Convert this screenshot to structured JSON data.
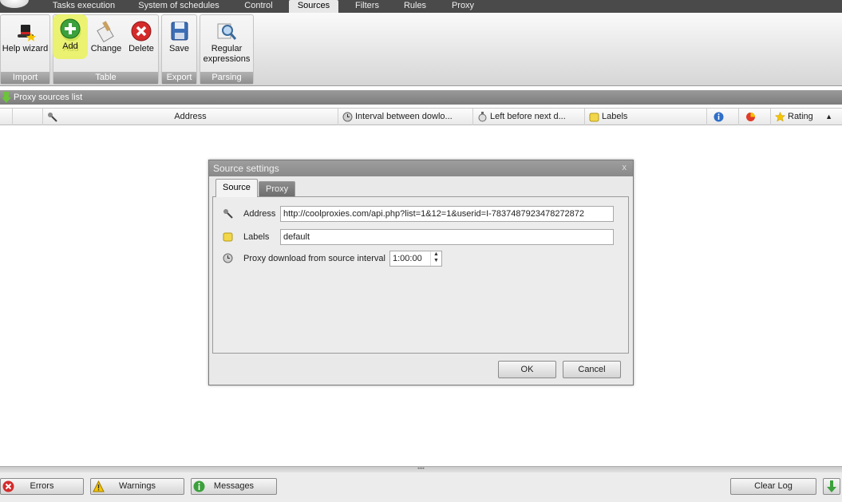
{
  "tabs": [
    "Tasks execution",
    "System of schedules",
    "Control",
    "Sources",
    "Filters",
    "Rules",
    "Proxy"
  ],
  "active_tab": "Sources",
  "ribbon": {
    "help_wizard": "Help wizard",
    "add": "Add",
    "change": "Change",
    "delete": "Delete",
    "save": "Save",
    "regular_expressions": [
      "Regular",
      "expressions"
    ],
    "groups": {
      "import": "Import",
      "table": "Table",
      "export": "Export",
      "parsing": "Parsing"
    }
  },
  "section_title": "Proxy sources list",
  "columns": {
    "address": "Address",
    "interval": "Interval between dowlo...",
    "left": "Left before next d...",
    "labels": "Labels",
    "rating": "Rating"
  },
  "dialog": {
    "title": "Source settings",
    "close": "x",
    "tab_source": "Source",
    "tab_proxy": "Proxy",
    "address_label": "Address",
    "address_value": "http://coolproxies.com/api.php?list=1&12=1&userid=I-7837487923478272872",
    "labels_label": "Labels",
    "labels_value": "default",
    "interval_label": "Proxy download from source interval",
    "interval_value": "1:00:00",
    "ok": "OK",
    "cancel": "Cancel"
  },
  "bottom": {
    "errors": "Errors",
    "warnings": "Warnings",
    "messages": "Messages",
    "clear_log": "Clear Log"
  },
  "colors": {
    "highlight": "#eaf25a",
    "add_green": "#3ca03c",
    "delete_red": "#d52a2a"
  }
}
